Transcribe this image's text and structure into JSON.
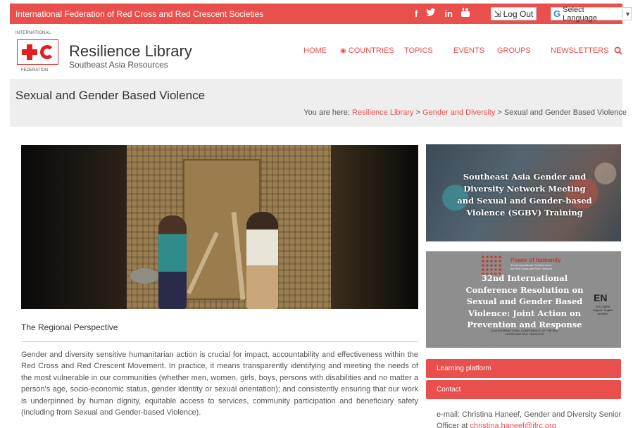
{
  "topbar": {
    "org_name": "International Federation of Red Cross and Red Crescent Societies",
    "social_icons": [
      "facebook-icon",
      "twitter-icon",
      "linkedin-icon",
      "youtube-icon"
    ],
    "logout_label": "Log Out",
    "language_label": "Select Language",
    "color": "#e94f4c"
  },
  "header": {
    "logo_top": "INTERNATIONAL",
    "logo_bottom": "FEDERATION",
    "site_title": "Resilience Library",
    "site_subtitle": "Southeast Asia Resources"
  },
  "nav": {
    "items": [
      "HOME",
      "COUNTRIES",
      "TOPICS",
      "EVENTS",
      "GROUPS",
      "NEWSLETTERS"
    ]
  },
  "page": {
    "title": "Sexual and Gender Based Violence",
    "breadcrumb_prefix": "You are here:",
    "breadcrumb": [
      "Resilience Library",
      "Gender and Diversity",
      "Sexual and Gender Based Violence"
    ]
  },
  "article": {
    "section_title": "The Regional Perspective",
    "body": "Gender and diversity sensitive humanitarian action is crucial for impact, accountability and effectiveness within the Red Cross and Red Crescent Movement. In practice, it means transparently identifying and meeting the needs of the most vulnerable in our communities (whether men, women, girls, boys, persons with disabilities and no matter a person's age, socio-economic status, gender identity or sexual orientation); and consistently ensuring that our work is underpinned by human dignity, equitable access to services, community participation and beneficiary safety (including from Sexual and Gender-based Violence)."
  },
  "sidebar": {
    "card1_text": "Southeast Asia Gender and Diversity Network Meeting and Sexual and Gender-based Violence (SGBV) Training",
    "card2": {
      "brand": "Power of humanity",
      "brand_sub": "32nd International Conference of the Red Cross and Red Crescent",
      "text": "32nd International Conference Resolution on Sexual and Gender Based Violence: Joint Action on Prevention and Response",
      "lang": "EN",
      "lang_sub": "32IC/15/R3 Original: English Adopted",
      "conf_sub": "32nd INTERNATIONAL CONFERENCE OF THE RED CROSS AND RED CRESCENT"
    },
    "buttons": [
      "Learning platform",
      "Contact"
    ],
    "contact_prefix": "e-mail: Christina Haneef, Gender and Diversity Senior Officer at ",
    "contact_email": "christina.haneef@ifrc.org"
  }
}
